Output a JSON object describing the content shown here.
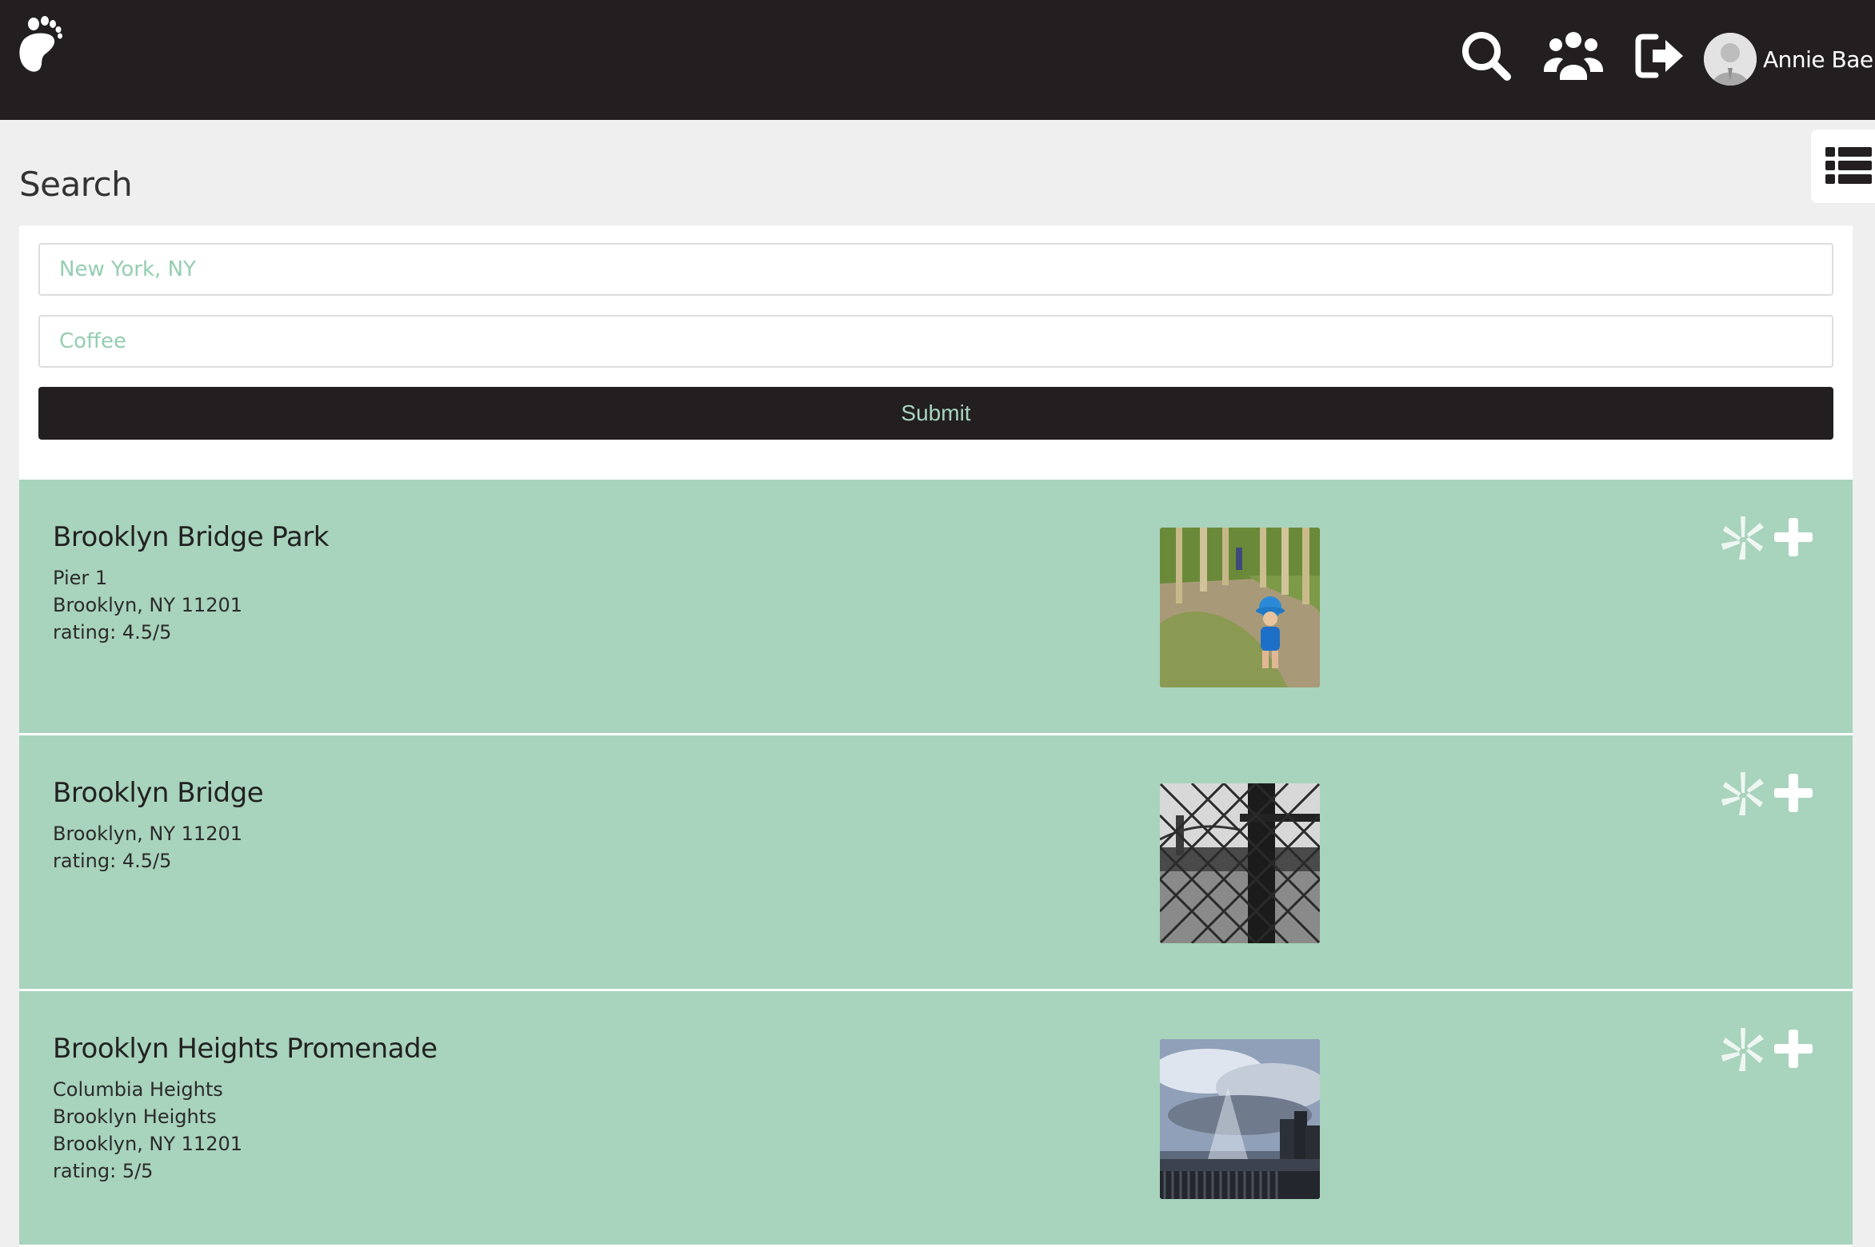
{
  "header": {
    "user_name": "Annie Bae",
    "icons": [
      "footprint-logo-icon",
      "search-icon",
      "friends-icon",
      "logout-icon",
      "user-avatar"
    ]
  },
  "page": {
    "title": "Search",
    "view_toggle_icon": "list-view-icon"
  },
  "search_form": {
    "location_placeholder": "New York, NY",
    "location_value": "",
    "term_placeholder": "Coffee",
    "term_value": "",
    "submit_label": "Submit"
  },
  "colors": {
    "header_bg": "#231f20",
    "accent_green": "#a8d3bd",
    "placeholder_green": "#95cdb0",
    "page_bg": "#efefef"
  },
  "results": [
    {
      "name": "Brooklyn Bridge Park",
      "address": [
        "Pier 1",
        "Brooklyn, NY 11201"
      ],
      "rating": "rating: 4.5/5",
      "thumbnail": "park-photo"
    },
    {
      "name": "Brooklyn Bridge",
      "address": [
        "Brooklyn, NY 11201"
      ],
      "rating": "rating: 4.5/5",
      "thumbnail": "bridge-photo"
    },
    {
      "name": "Brooklyn Heights Promenade",
      "address": [
        "Columbia Heights",
        "Brooklyn Heights",
        "Brooklyn, NY 11201"
      ],
      "rating": "rating: 5/5",
      "thumbnail": "skyline-photo"
    }
  ]
}
